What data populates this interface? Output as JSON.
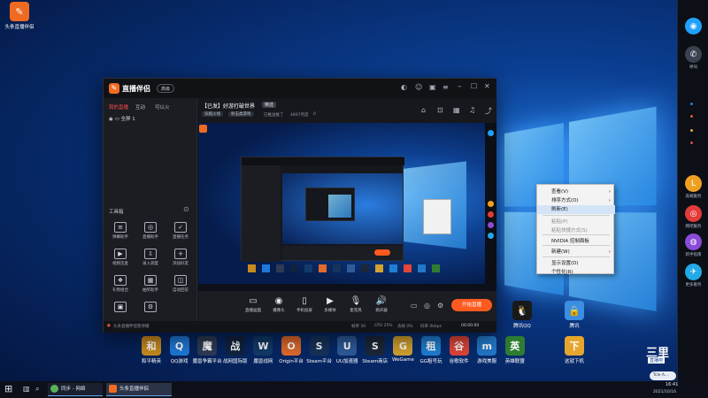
{
  "desktop": {
    "top_icon_label": "头条直播伴侣",
    "shortcuts": [
      {
        "label": "和平精英",
        "color": "#c88a1e",
        "glyph": "和"
      },
      {
        "label": "QQ游戏",
        "color": "#1e78d8",
        "glyph": "Q"
      },
      {
        "label": "魔兽争霸平台",
        "color": "#2e3b56",
        "glyph": "魔"
      },
      {
        "label": "战网国际版",
        "color": "#10233f",
        "glyph": "战"
      },
      {
        "label": "魔兽战网",
        "color": "#123a6a",
        "glyph": "W"
      },
      {
        "label": "Origin平台",
        "color": "#e06a2c",
        "glyph": "O"
      },
      {
        "label": "Steam平台",
        "color": "#16335a",
        "glyph": "S"
      },
      {
        "label": "UU加速器",
        "color": "#2f5b9a",
        "glyph": "U"
      },
      {
        "label": "Steam商店",
        "color": "#1b2838",
        "glyph": "S"
      },
      {
        "label": "WeGame",
        "color": "#d2a230",
        "glyph": "G"
      },
      {
        "label": "GG租号玩",
        "color": "#1f7fd3",
        "glyph": "租"
      },
      {
        "label": "谷歌软件",
        "color": "#e0463a",
        "glyph": "谷"
      },
      {
        "label": "游戏美服",
        "color": "#2278c9",
        "glyph": "m"
      },
      {
        "label": "英雄联盟",
        "color": "#2e7d32",
        "glyph": "英"
      }
    ],
    "right_icons": [
      {
        "label": "腾讯QQ",
        "color": "#1a1a1a",
        "glyph": "🐧"
      },
      {
        "label": "腾讯",
        "color": "#3b8ee0",
        "glyph": "🔒"
      },
      {
        "label": "这就下机",
        "color": "#e6a52c",
        "glyph": "下"
      }
    ],
    "watermark_brand": "三里",
    "watermark_sub": "直播吧",
    "qq_chip": "Tcle A...",
    "qq_chip_dot": "6"
  },
  "right_sidebar": {
    "items": [
      {
        "label": "",
        "glyph": "◉",
        "color": "#1fa2ff"
      },
      {
        "label": "呼叫",
        "glyph": "✆",
        "color": "#3a4150"
      },
      {
        "label": "高端服务",
        "glyph": "L",
        "color": "#f0a020"
      },
      {
        "label": "网吧服务",
        "glyph": "◎",
        "color": "#e43a3a"
      },
      {
        "label": "新手指南",
        "glyph": "◍",
        "color": "#8a4bd8"
      },
      {
        "label": "更多服务",
        "glyph": "✈",
        "color": "#23a8e8"
      }
    ]
  },
  "app": {
    "brand": "直播伴侣",
    "brand_badge": "高级",
    "left_tabs": [
      "我的直播",
      "互动",
      "可以火"
    ],
    "scene_item": "全屏 1",
    "title": "【已发】好游打破世界",
    "title_badge": "精选",
    "subtitle_chips": [
      "穿越火线",
      "射击类游戏"
    ],
    "stats": [
      "已推送推了",
      "4897月度",
      "0"
    ],
    "tools_header": "工具箱",
    "tools": [
      {
        "label": "弹幕助手",
        "glyph": "≡"
      },
      {
        "label": "直播助手",
        "glyph": "◎"
      },
      {
        "label": "直播任务",
        "glyph": "✓"
      },
      {
        "label": "视频连麦",
        "glyph": "▶"
      },
      {
        "label": "录入调度",
        "glyph": "⇩"
      },
      {
        "label": "添加好友",
        "glyph": "+"
      },
      {
        "label": "礼物组合",
        "glyph": "❖"
      },
      {
        "label": "抽奖助手",
        "glyph": "▦"
      },
      {
        "label": "自动回答",
        "glyph": "◫"
      },
      {
        "label": "",
        "glyph": "▣"
      },
      {
        "label": "",
        "glyph": "⚙"
      }
    ],
    "bottom_buttons": [
      {
        "label": "直播画面",
        "glyph": "▭"
      },
      {
        "label": "摄像头",
        "glyph": "◉"
      },
      {
        "label": "手机投屏",
        "glyph": "▯"
      },
      {
        "label": "多媒体",
        "glyph": "▶"
      },
      {
        "label": "麦克风",
        "glyph": "🎙"
      },
      {
        "label": "扬声器",
        "glyph": "🔊"
      }
    ],
    "start_button": "开始直播",
    "status_left": "头条直播伴侣暂停播",
    "status_items": [
      "帧率 30",
      "CPU 25%",
      "丢帧 0%",
      "码率 0kbps"
    ],
    "timer": "00:00:00"
  },
  "context_menu": {
    "items": [
      {
        "label": "查看(V)",
        "arrow": true,
        "disabled": false
      },
      {
        "label": "排序方式(O)",
        "arrow": true,
        "disabled": false
      },
      {
        "label": "刷新(E)",
        "arrow": false,
        "disabled": false,
        "selected": true
      },
      {
        "label": "粘贴(P)",
        "arrow": false,
        "disabled": true
      },
      {
        "label": "粘贴快捷方式(S)",
        "arrow": false,
        "disabled": true
      },
      {
        "label": "NVIDIA 控制面板",
        "arrow": false,
        "disabled": false
      },
      {
        "label": "新建(W)",
        "arrow": true,
        "disabled": false
      },
      {
        "label": "显示设置(D)",
        "arrow": false,
        "disabled": false
      },
      {
        "label": "个性化(R)",
        "arrow": false,
        "disabled": false
      }
    ]
  },
  "taskbar": {
    "start_glyph": "⊞",
    "items": [
      "同步 - 网络",
      "头条直播伴侣"
    ],
    "time": "16:41",
    "date": "2021/10/16"
  }
}
